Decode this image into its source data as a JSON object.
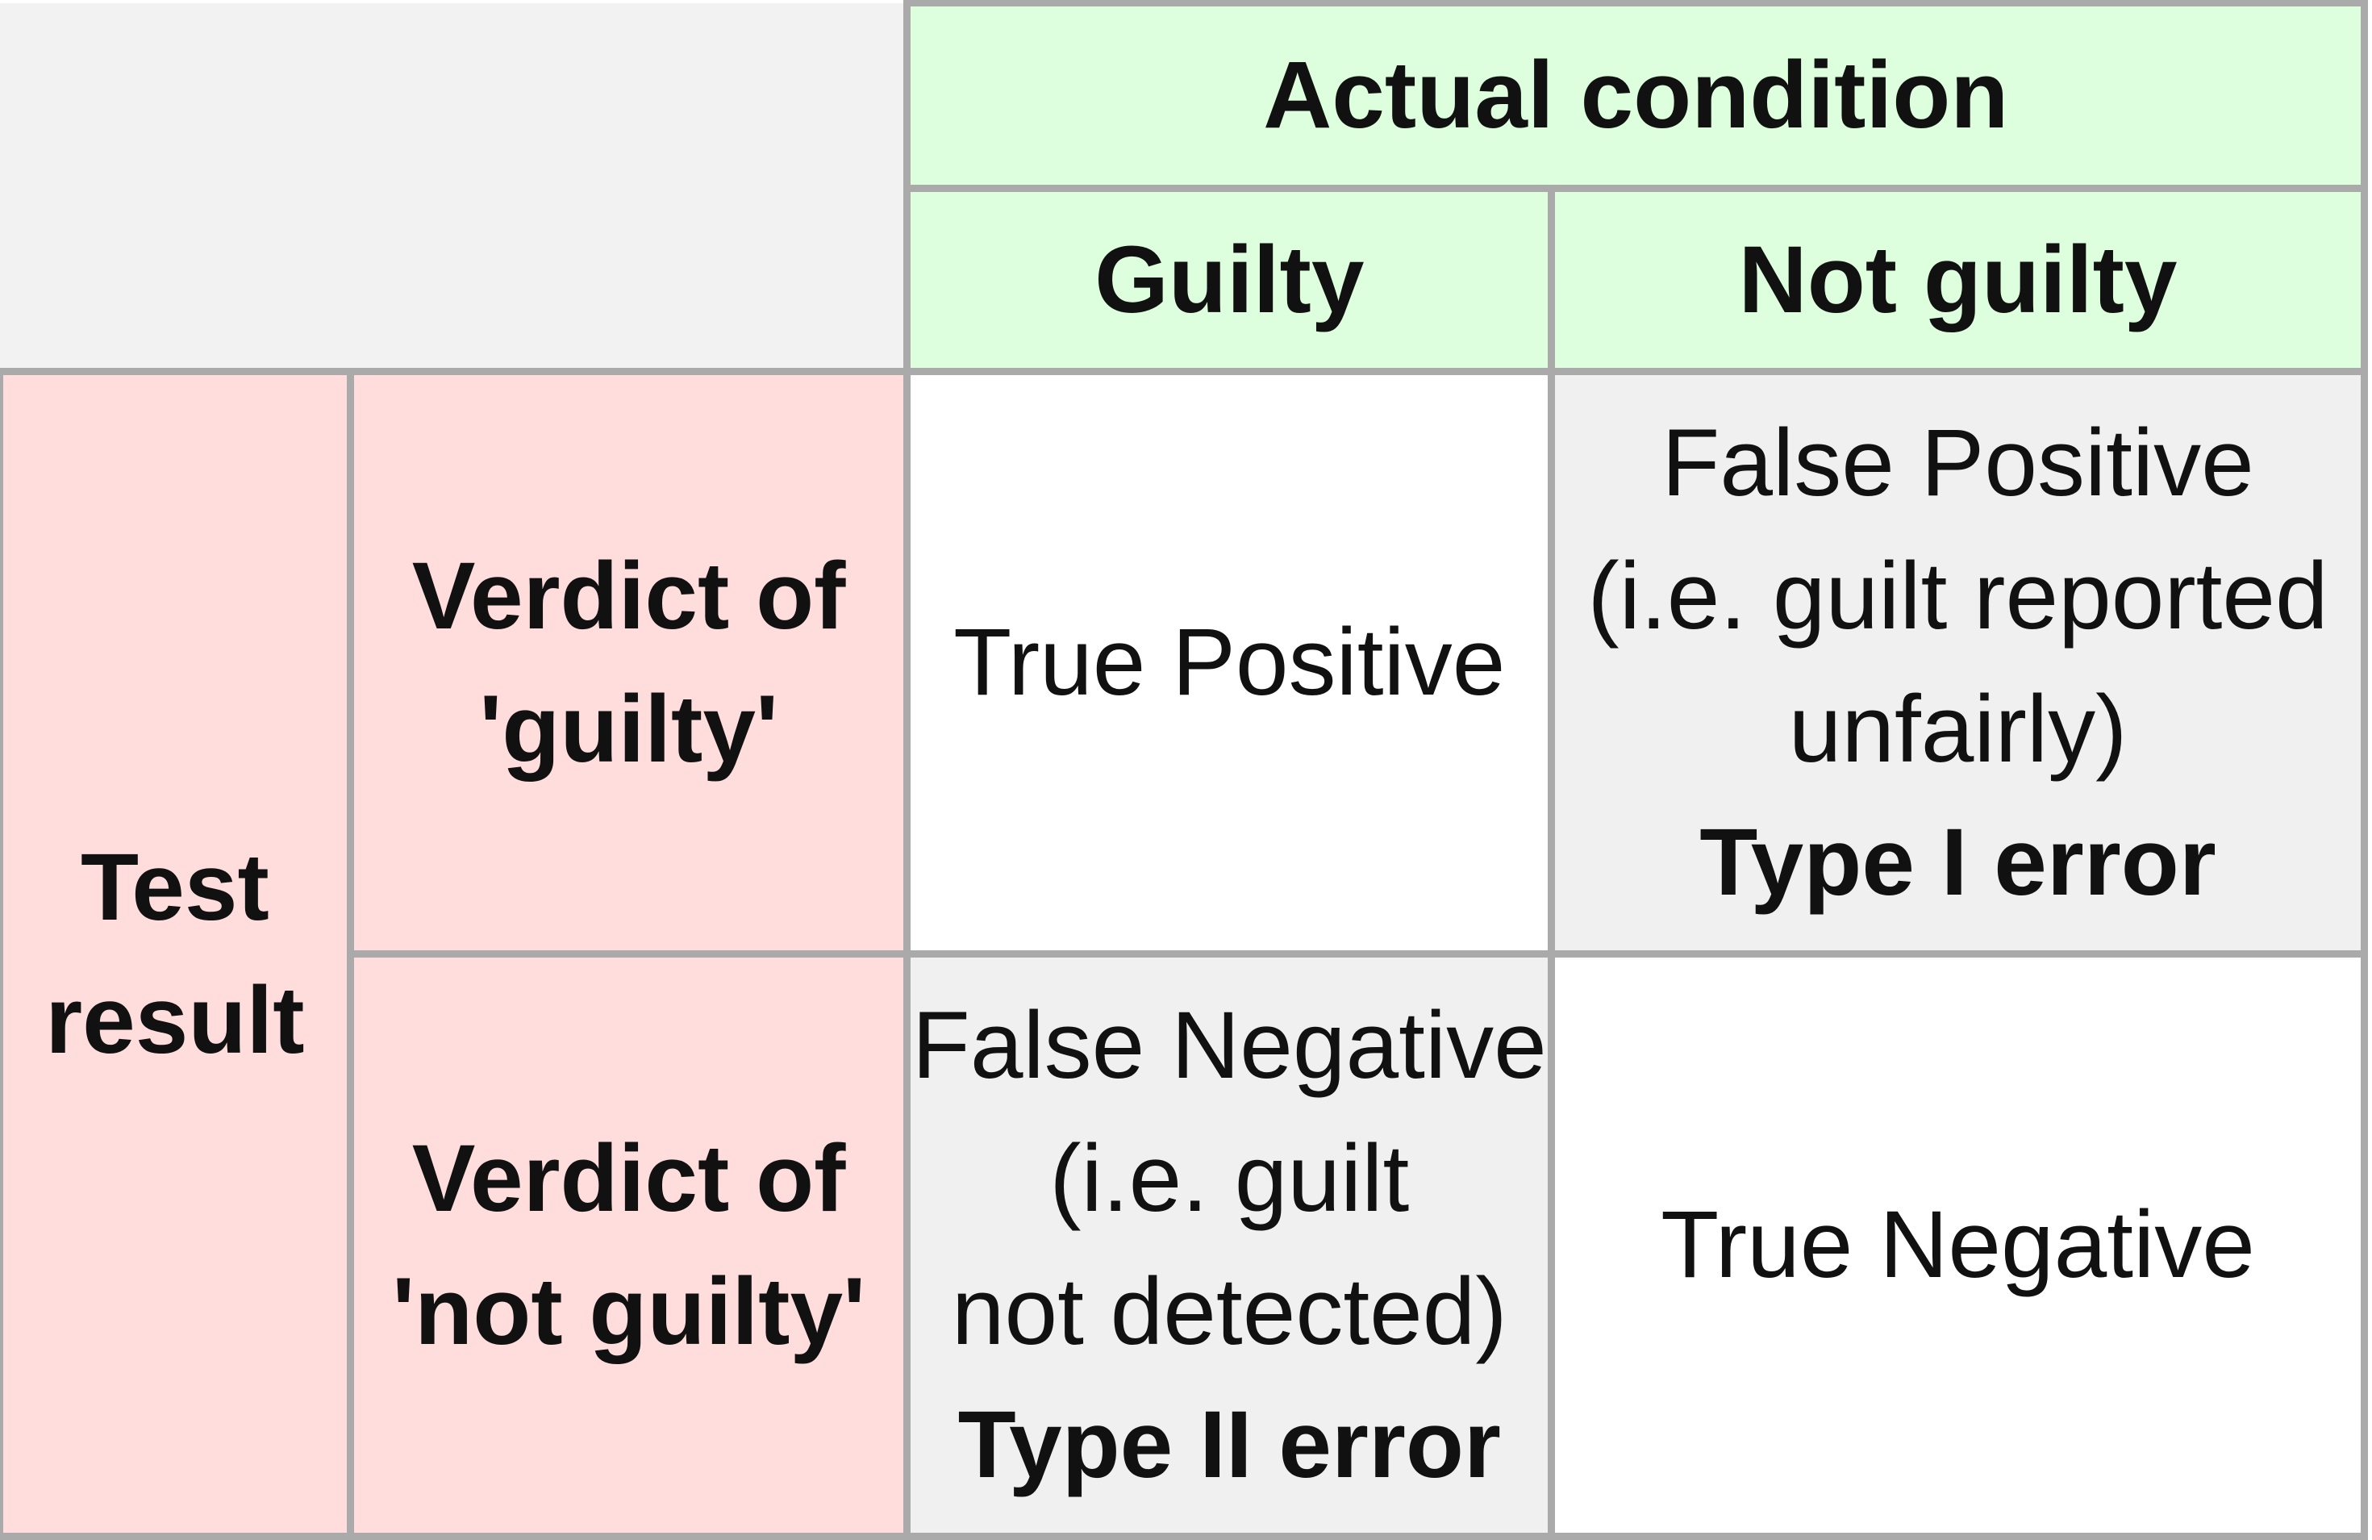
{
  "header": {
    "actual_condition": "Actual condition",
    "columns": [
      "Guilty",
      "Not guilty"
    ]
  },
  "rows_header": {
    "test_result": [
      "Test",
      "result"
    ],
    "rows": [
      [
        "Verdict of",
        "'guilty'"
      ],
      [
        "Verdict of",
        "'not guilty'"
      ]
    ]
  },
  "cells": {
    "true_positive": "True Positive",
    "false_positive": {
      "lines": [
        "False Positive",
        "(i.e. guilt reported",
        "unfairly)"
      ],
      "type": "Type I error"
    },
    "false_negative": {
      "lines": [
        "False Negative",
        "(i.e. guilt",
        "not detected)"
      ],
      "type": "Type II error"
    },
    "true_negative": "True Negative"
  },
  "colors": {
    "header_green": "#ddffdd",
    "row_header_pink": "#ffdddd",
    "error_cell_grey": "#f0f0f0",
    "corner_grey": "#f2f2f2",
    "border": "#aaaaaa"
  }
}
